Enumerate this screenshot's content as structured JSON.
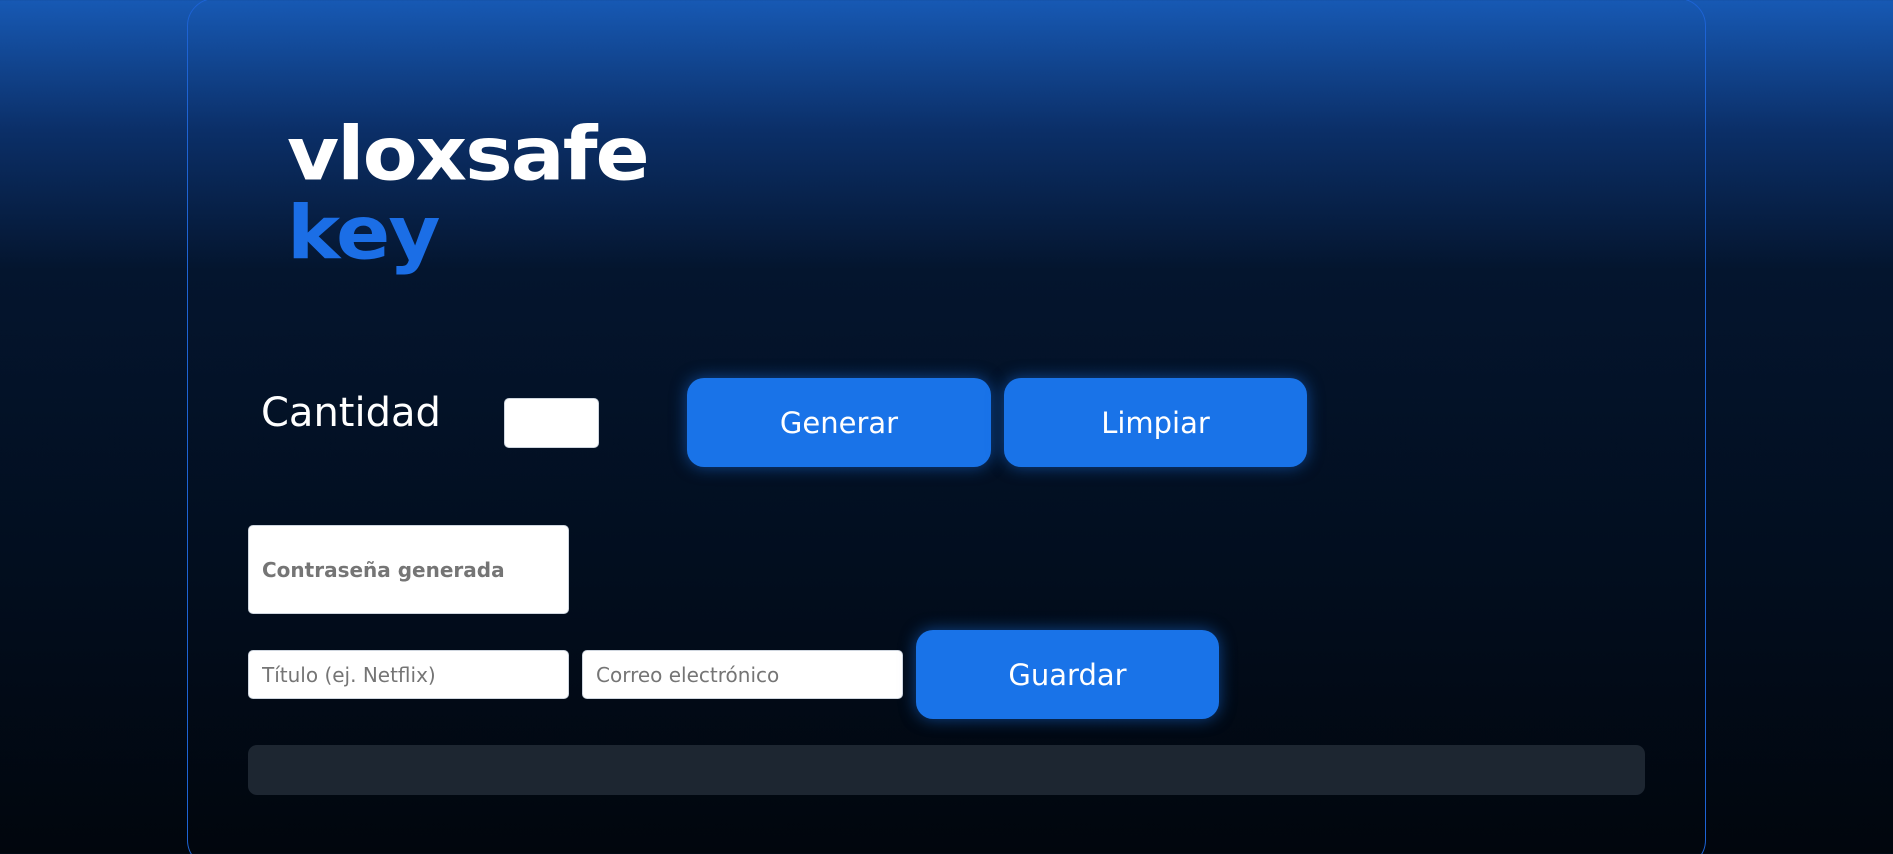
{
  "logo": {
    "line1": "vloxsafe",
    "line2": "key"
  },
  "generator": {
    "quantity_label": "Cantidad",
    "quantity_value": "",
    "generate_label": "Generar",
    "clear_label": "Limpiar",
    "generated_password_placeholder": "Contraseña generada"
  },
  "save_form": {
    "title_placeholder": "Título (ej. Netflix)",
    "email_placeholder": "Correo electrónico",
    "save_label": "Guardar"
  },
  "output": {
    "text": ""
  },
  "colors": {
    "accent": "#1973e8",
    "logo_accent": "#1b6ee6",
    "card_border": "#1d63d4",
    "output_bar": "#1d2631"
  }
}
